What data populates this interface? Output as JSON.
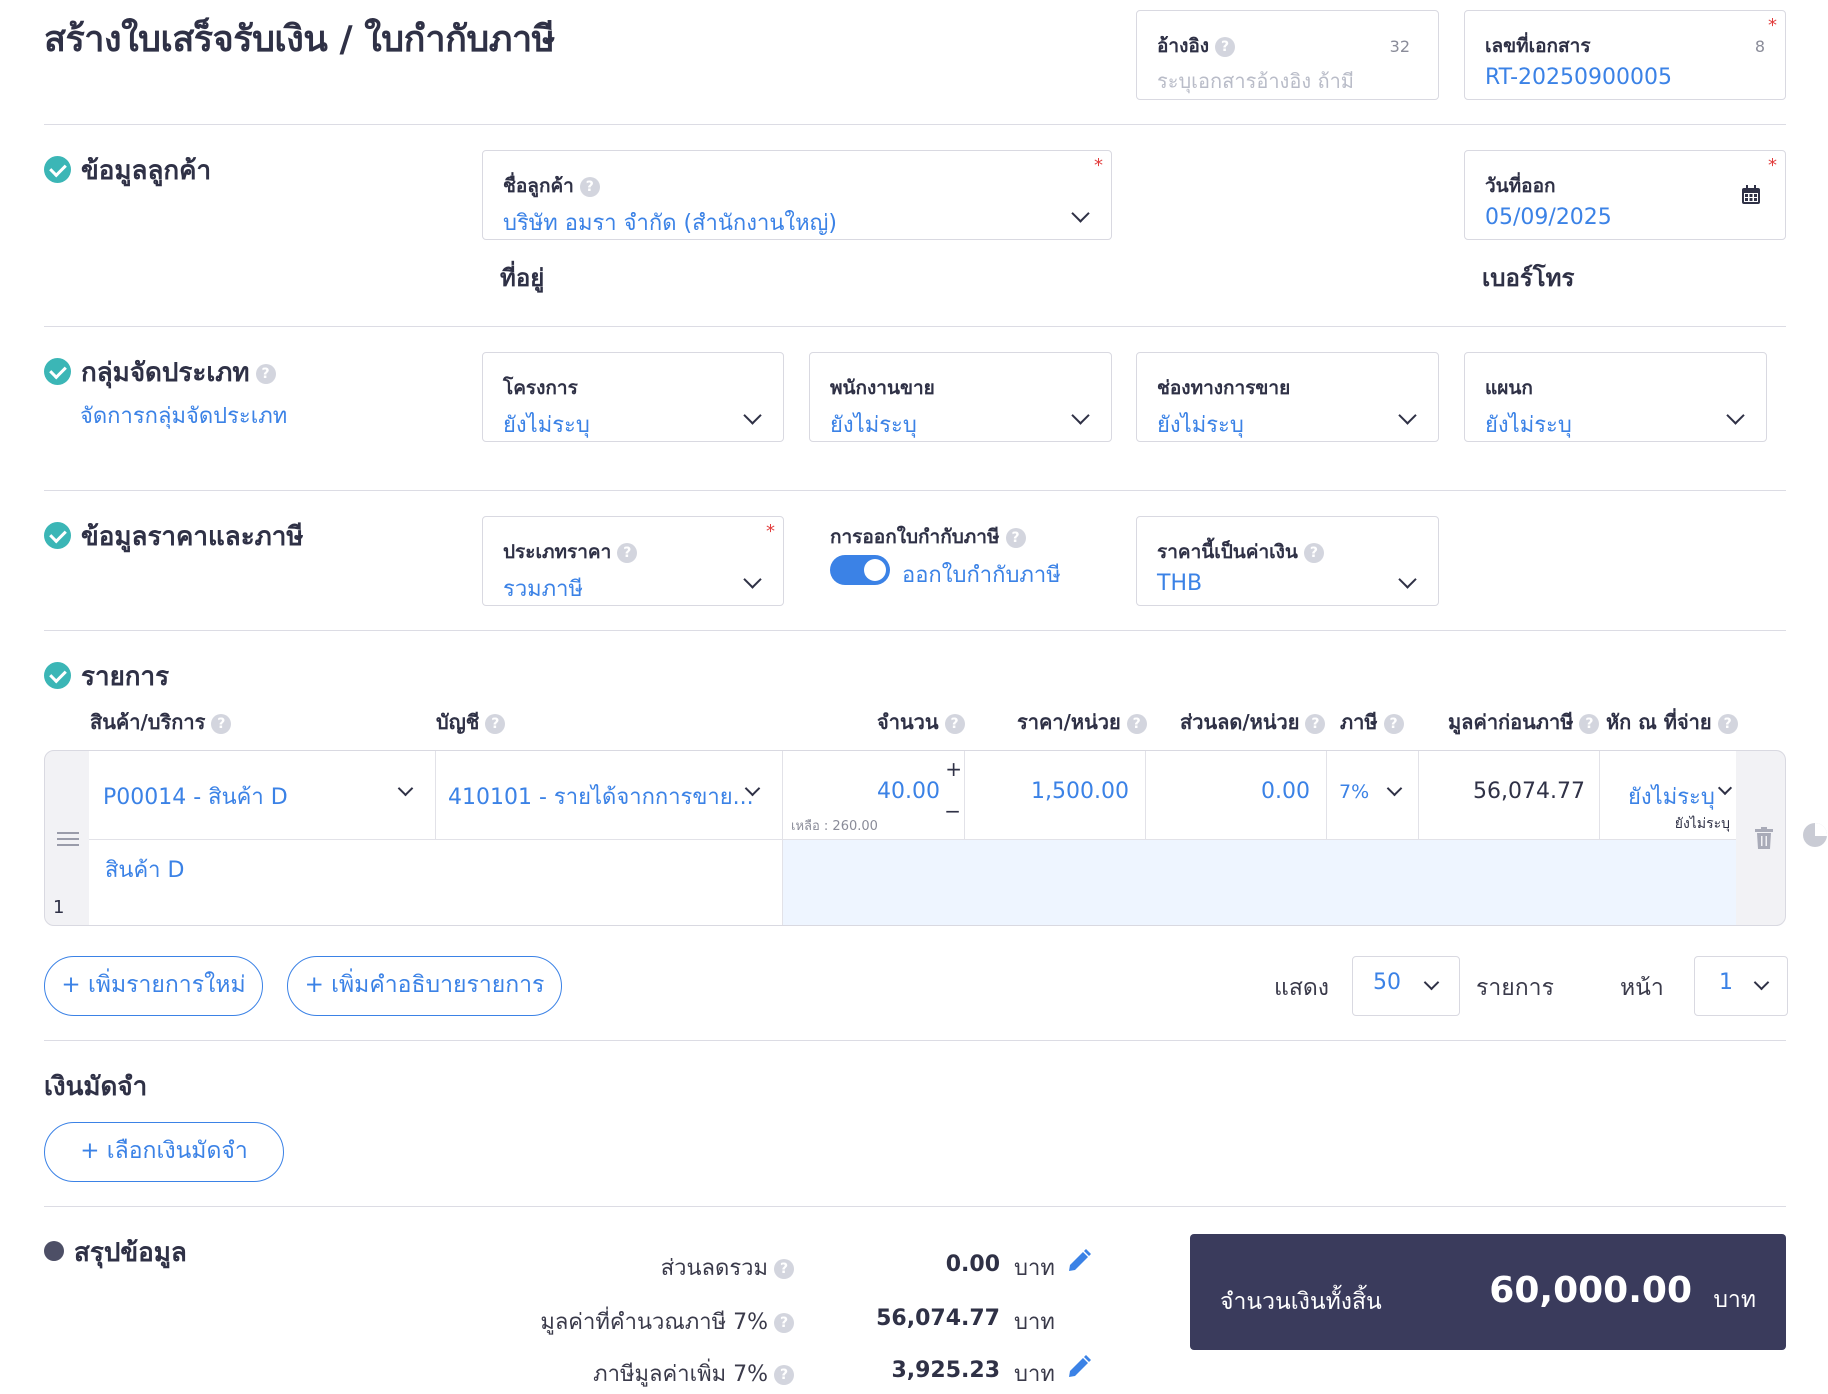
{
  "page": {
    "title": "สร้างใบเสร็จรับเงิน / ใบกำกับภาษี"
  },
  "header": {
    "reference": {
      "label": "อ้างอิง",
      "placeholder": "ระบุเอกสารอ้างอิง ถ้ามี",
      "count": "32"
    },
    "doc_number": {
      "label": "เลขที่เอกสาร",
      "value": "RT-20250900005",
      "count": "8",
      "required": "*"
    }
  },
  "customer_section": {
    "title": "ข้อมูลลูกค้า",
    "customer": {
      "label": "ชื่อลูกค้า",
      "value": "บริษัท อมรา จำกัด (สำนักงานใหญ่)",
      "required": "*"
    },
    "issue_date": {
      "label": "วันที่ออก",
      "value": "05/09/2025",
      "required": "*"
    },
    "address_label": "ที่อยู่",
    "phone_label": "เบอร์โทร"
  },
  "category_section": {
    "title": "กลุ่มจัดประเภท",
    "manage_link": "จัดการกลุ่มจัดประเภท",
    "fields": [
      {
        "label": "โครงการ",
        "value": "ยังไม่ระบุ"
      },
      {
        "label": "พนักงานขาย",
        "value": "ยังไม่ระบุ"
      },
      {
        "label": "ช่องทางการขาย",
        "value": "ยังไม่ระบุ"
      },
      {
        "label": "แผนก",
        "value": "ยังไม่ระบุ"
      }
    ]
  },
  "price_section": {
    "title": "ข้อมูลราคาและภาษี",
    "price_type": {
      "label": "ประเภทราคา",
      "value": "รวมภาษี",
      "required": "*"
    },
    "tax_invoice": {
      "label": "การออกใบกำกับภาษี",
      "value": "ออกใบกำกับภาษี",
      "enabled": true
    },
    "currency": {
      "label": "ราคานี้เป็นค่าเงิน",
      "value": "THB"
    }
  },
  "items_section": {
    "title": "รายการ",
    "columns": [
      "สินค้า/บริการ",
      "บัญชี",
      "จำนวน",
      "ราคา/หน่วย",
      "ส่วนลด/หน่วย",
      "ภาษี",
      "มูลค่าก่อนภาษี",
      "หัก ณ ที่จ่าย"
    ],
    "rows": [
      {
        "index": "1",
        "product": "P00014 - สินค้า D",
        "account": "410101 - รายได้จากการขาย...",
        "quantity": "40.00",
        "remaining": "เหลือ : 260.00",
        "unit_price": "1,500.00",
        "discount": "0.00",
        "tax": "7%",
        "pre_tax": "56,074.77",
        "withholding": "ยังไม่ระบุ",
        "withholding_sub": "ยังไม่ระบุ",
        "description": "สินค้า D"
      }
    ],
    "add_item": "+ เพิ่มรายการใหม่",
    "add_description": "+ เพิ่มคำอธิบายรายการ",
    "show_label": "แสดง",
    "page_size": "50",
    "items_label": "รายการ",
    "page_label": "หน้า",
    "page_number": "1"
  },
  "deposit_section": {
    "title": "เงินมัดจำ",
    "select_button": "+ เลือกเงินมัดจำ"
  },
  "summary": {
    "title": "สรุปข้อมูล",
    "lines": [
      {
        "label": "ส่วนลดรวม",
        "value": "0.00",
        "unit": "บาท",
        "editable": true
      },
      {
        "label": "มูลค่าที่คำนวณภาษี 7%",
        "value": "56,074.77",
        "unit": "บาท",
        "editable": false
      },
      {
        "label": "ภาษีมูลค่าเพิ่ม 7%",
        "value": "3,925.23",
        "unit": "บาท",
        "editable": true
      }
    ],
    "total_label": "จำนวนเงินทั้งสิ้น",
    "total_value": "60,000.00",
    "total_unit": "บาท"
  },
  "colors": {
    "accent": "#3b82e6",
    "check": "#3bb6b6",
    "total_bg": "#3a3b5c",
    "required": "#e23d3d"
  }
}
